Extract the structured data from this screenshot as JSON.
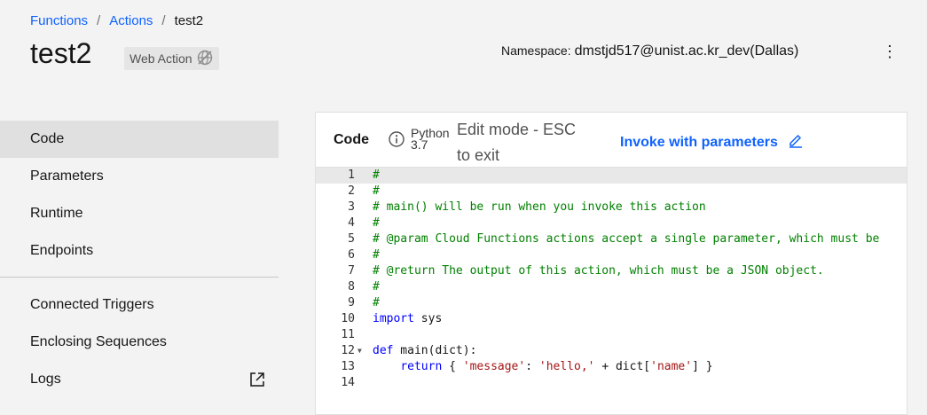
{
  "breadcrumb": {
    "items": [
      "Functions",
      "Actions"
    ],
    "separator": "/",
    "current": "test2"
  },
  "page": {
    "title": "test2",
    "badge": "Web Action"
  },
  "namespace": {
    "label": "Namespace:",
    "value": "dmstjd517@unist.ac.kr_dev(Dallas)"
  },
  "overflow_menu": {
    "glyph": "⋮"
  },
  "sidebar": {
    "items": [
      "Code",
      "Parameters",
      "Runtime",
      "Endpoints"
    ],
    "items2": [
      "Connected Triggers",
      "Enclosing Sequences",
      "Logs"
    ]
  },
  "panel": {
    "title": "Code",
    "runtime": "Python 3.7",
    "edit_mode_bold": "Edit mode - ESC",
    "edit_mode_rest": "to exit",
    "invoke_label": "Invoke with parameters"
  },
  "editor": {
    "lines": [
      {
        "num": "1",
        "parts": [
          [
            "comment",
            "#"
          ]
        ]
      },
      {
        "num": "2",
        "parts": [
          [
            "comment",
            "#"
          ]
        ]
      },
      {
        "num": "3",
        "parts": [
          [
            "comment",
            "# main() will be run when you invoke this action"
          ]
        ]
      },
      {
        "num": "4",
        "parts": [
          [
            "comment",
            "#"
          ]
        ]
      },
      {
        "num": "5",
        "parts": [
          [
            "comment",
            "# @param Cloud Functions actions accept a single parameter, which must be"
          ]
        ]
      },
      {
        "num": "6",
        "parts": [
          [
            "comment",
            "#"
          ]
        ]
      },
      {
        "num": "7",
        "parts": [
          [
            "comment",
            "# @return The output of this action, which must be a JSON object."
          ]
        ]
      },
      {
        "num": "8",
        "parts": [
          [
            "comment",
            "#"
          ]
        ]
      },
      {
        "num": "9",
        "parts": [
          [
            "comment",
            "#"
          ]
        ]
      },
      {
        "num": "10",
        "parts": [
          [
            "keyword",
            "import"
          ],
          [
            "plain",
            " sys"
          ]
        ]
      },
      {
        "num": "11",
        "parts": []
      },
      {
        "num": "12",
        "parts": [
          [
            "keyword",
            "def"
          ],
          [
            "plain",
            " main(dict):"
          ]
        ]
      },
      {
        "num": "13",
        "parts": [
          [
            "plain",
            "    "
          ],
          [
            "keyword",
            "return"
          ],
          [
            "plain",
            " { "
          ],
          [
            "string",
            "'message'"
          ],
          [
            "plain",
            ": "
          ],
          [
            "string",
            "'hello,'"
          ],
          [
            "plain",
            " + dict["
          ],
          [
            "string",
            "'name'"
          ],
          [
            "plain",
            "] }"
          ]
        ]
      },
      {
        "num": "14",
        "parts": []
      }
    ]
  }
}
